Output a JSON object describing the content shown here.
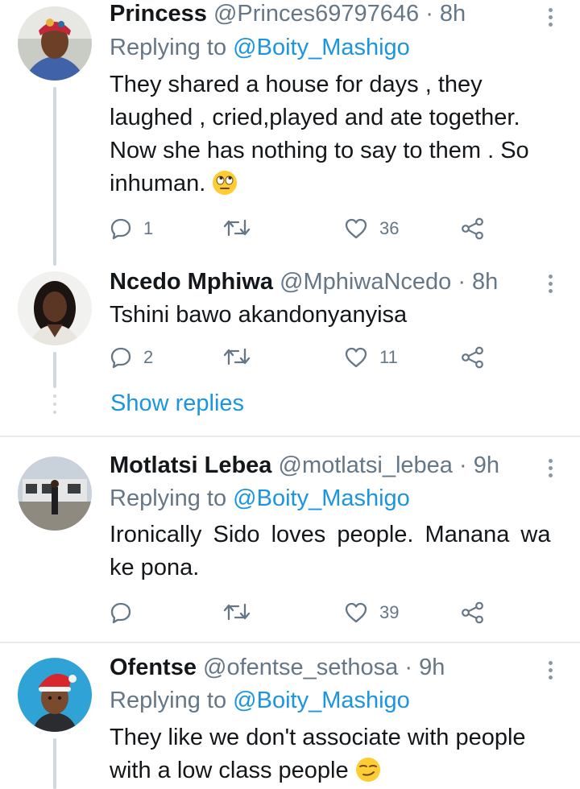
{
  "tweets": [
    {
      "name": "Princess",
      "handle": "@Princes69797646",
      "time": "· 8h",
      "replying_prefix": "Replying to",
      "replying_to": "@Boity_Mashigo",
      "lines": [
        "They shared a house for days , they",
        "laughed , cried,played and ate together.",
        "Now she has nothing to say to them . So",
        "inhuman."
      ],
      "emoji": "rolling-eyes-emoji",
      "reply_count": "1",
      "retweet_count": "",
      "like_count": "36"
    },
    {
      "name": "Ncedo Mphiwa",
      "handle": "@MphiwaNcedo",
      "time": "· 8h",
      "lines": [
        "Tshini bawo akandonyanyisa"
      ],
      "reply_count": "2",
      "retweet_count": "",
      "like_count": "11"
    },
    {
      "name": "Motlatsi Lebea",
      "handle": "@motlatsi_lebea",
      "time": "· 9h",
      "replying_prefix": "Replying to",
      "replying_to": "@Boity_Mashigo",
      "lines": [
        "Ironically Sido loves people. Manana wa",
        "ke pona."
      ],
      "reply_count": "",
      "retweet_count": "",
      "like_count": "39"
    },
    {
      "name": "Ofentse",
      "handle": "@ofentse_sethosa",
      "time": "· 9h",
      "replying_prefix": "Replying to",
      "replying_to": "@Boity_Mashigo",
      "lines": [
        "They like we don't associate with people",
        "with a low class people"
      ],
      "emoji": "smirk-emoji"
    }
  ],
  "show_replies": "Show replies",
  "colors": {
    "accent": "#1b95e0",
    "muted": "#657786",
    "text": "#14171a",
    "divider": "#e6ecf0"
  }
}
